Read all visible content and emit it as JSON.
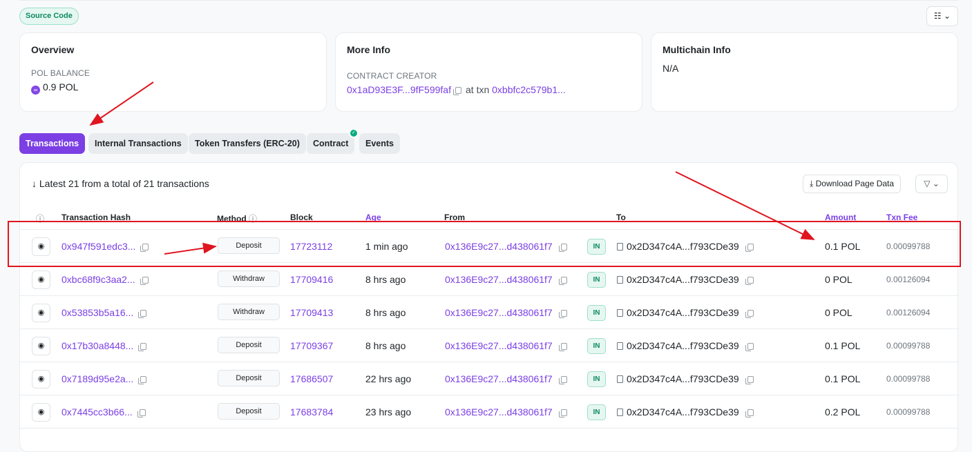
{
  "source_badge": "Source Code",
  "view_button": "☷ ⌄",
  "overview": {
    "title": "Overview",
    "balance_label": "POL BALANCE",
    "balance_value": "0.9 POL"
  },
  "more_info": {
    "title": "More Info",
    "creator_label": "CONTRACT CREATOR",
    "creator_address": "0x1aD93E3F...9fF599faf",
    "at_txn": "at txn",
    "txn_hash": "0xbbfc2c579b1..."
  },
  "multichain": {
    "title": "Multichain Info",
    "value": "N/A"
  },
  "tabs": [
    {
      "label": "Transactions"
    },
    {
      "label": "Internal Transactions"
    },
    {
      "label": "Token Transfers (ERC-20)"
    },
    {
      "label": "Contract"
    },
    {
      "label": "Events"
    }
  ],
  "summary": "↓ Latest 21 from a total of 21 transactions",
  "download_label": "Download Page Data",
  "filter_label": "▽ ⌄",
  "columns": [
    "Transaction Hash",
    "Method",
    "Block",
    "Age",
    "From",
    "To",
    "Amount",
    "Txn Fee"
  ],
  "rows": [
    {
      "hash": "0x947f591edc3...",
      "method": "Deposit",
      "block": "17723112",
      "age": "1 min ago",
      "from": "0x136E9c27...d438061f7",
      "dir": "IN",
      "to": "0x2D347c4A...f793CDe39",
      "amount": "0.1 POL",
      "fee": "0.00099788"
    },
    {
      "hash": "0xbc68f9c3aa2...",
      "method": "Withdraw",
      "block": "17709416",
      "age": "8 hrs ago",
      "from": "0x136E9c27...d438061f7",
      "dir": "IN",
      "to": "0x2D347c4A...f793CDe39",
      "amount": "0 POL",
      "fee": "0.00126094"
    },
    {
      "hash": "0x53853b5a16...",
      "method": "Withdraw",
      "block": "17709413",
      "age": "8 hrs ago",
      "from": "0x136E9c27...d438061f7",
      "dir": "IN",
      "to": "0x2D347c4A...f793CDe39",
      "amount": "0 POL",
      "fee": "0.00126094"
    },
    {
      "hash": "0x17b30a8448...",
      "method": "Deposit",
      "block": "17709367",
      "age": "8 hrs ago",
      "from": "0x136E9c27...d438061f7",
      "dir": "IN",
      "to": "0x2D347c4A...f793CDe39",
      "amount": "0.1 POL",
      "fee": "0.00099788"
    },
    {
      "hash": "0x7189d95e2a...",
      "method": "Deposit",
      "block": "17686507",
      "age": "22 hrs ago",
      "from": "0x136E9c27...d438061f7",
      "dir": "IN",
      "to": "0x2D347c4A...f793CDe39",
      "amount": "0.1 POL",
      "fee": "0.00099788"
    },
    {
      "hash": "0x7445cc3b66...",
      "method": "Deposit",
      "block": "17683784",
      "age": "23 hrs ago",
      "from": "0x136E9c27...d438061f7",
      "dir": "IN",
      "to": "0x2D347c4A...f793CDe39",
      "amount": "0.2 POL",
      "fee": "0.00099788"
    }
  ],
  "colors": {
    "accent": "#7b3fe4",
    "annotation": "#e0151f",
    "in_badge": "#0b8a62"
  }
}
